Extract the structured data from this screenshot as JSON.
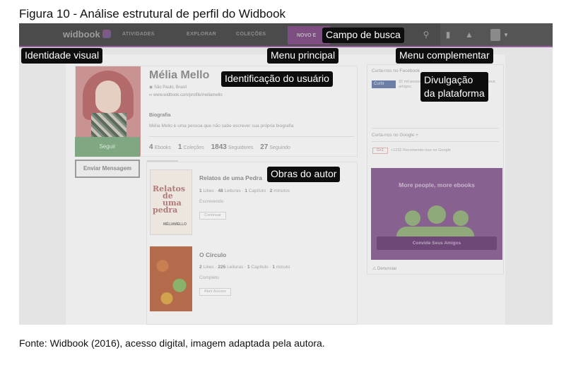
{
  "figure": {
    "title": "Figura 10 - Análise estrutural de perfil do Widbook",
    "source": "Fonte: Widbook (2016), acesso digital, imagem adaptada pela autora."
  },
  "callouts": {
    "search": "Campo de busca",
    "identity": "Identidade visual",
    "main_menu": "Menu principal",
    "extra_menu": "Menu complementar",
    "user_id": "Identificação do usuário",
    "promo_line1": "Divulgação",
    "promo_line2": "da plataforma",
    "works": "Obras do autor"
  },
  "nav": {
    "logo": "widbook",
    "items": [
      "ATIVIDADES",
      "EXPLORAR",
      "COLEÇÕES"
    ],
    "new_label": "NOVO E"
  },
  "profile": {
    "name": "Mélia Mello",
    "location": "São Paulo, Brasil",
    "url": "www.widbook.com/profile/meliamello",
    "bio_label": "Biografia",
    "bio": "Mélia Mello é uma pessoa que não sabe escrever sua própria biografia",
    "stats": [
      {
        "n": "4",
        "label": "Ebooks"
      },
      {
        "n": "1",
        "label": "Coleções"
      },
      {
        "n": "1843",
        "label": "Seguidores"
      },
      {
        "n": "27",
        "label": "Seguindo"
      }
    ],
    "follow_button": "Seguir",
    "message_button": "Enviar Mensagem"
  },
  "works": [
    {
      "title": "Relatos de uma Pedra",
      "likes": "1",
      "likes_label": "Likes",
      "reads": "48",
      "reads_label": "Leituras",
      "chapters": "1",
      "chapters_label": "Capítulo",
      "minutes": "2",
      "minutes_label": "minutos",
      "status": "Escrevendo",
      "button": "Continuar",
      "cover_text": [
        "Relatos",
        "de uma",
        "pedra"
      ],
      "cover_author": "MÉLIAMELLO"
    },
    {
      "title": "O Círculo",
      "likes": "2",
      "likes_label": "Likes",
      "reads": "225",
      "reads_label": "Leituras",
      "chapters": "1",
      "chapters_label": "Capítulo",
      "minutes": "1",
      "minutes_label": "minuto",
      "status": "Completo",
      "button": "Abrir Acesso"
    }
  ],
  "sidebar": {
    "facebook_heading": "Curta-nos no Facebook",
    "facebook_button": "Curtir",
    "facebook_text": "32 mil pessoas curtiram isso. Seja a primeira entre seus amigos.",
    "google_heading": "Curta-nos no Google +",
    "google_button": "G+1",
    "google_text": "+1232  Recomende isso no Google",
    "promo_title": "More people, more ebooks",
    "promo_button": "Convide Seus Amigos",
    "report": "Denunciar"
  }
}
